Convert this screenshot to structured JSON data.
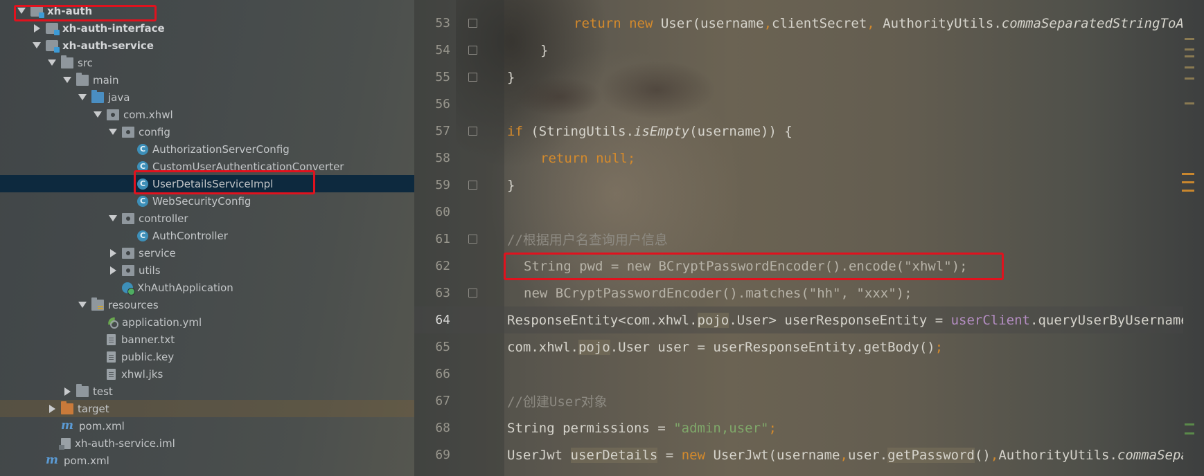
{
  "tree": {
    "items": [
      {
        "label": "xh-auth",
        "arrow": "down",
        "icon": "module",
        "depth": 0,
        "bold": true
      },
      {
        "label": "xh-auth-interface",
        "arrow": "right",
        "icon": "module",
        "depth": 1,
        "bold": true
      },
      {
        "label": "xh-auth-service",
        "arrow": "down",
        "icon": "module",
        "depth": 1,
        "bold": true
      },
      {
        "label": "src",
        "arrow": "down",
        "icon": "folder",
        "depth": 2
      },
      {
        "label": "main",
        "arrow": "down",
        "icon": "folder",
        "depth": 3
      },
      {
        "label": "java",
        "arrow": "down",
        "icon": "folder-blue",
        "depth": 4
      },
      {
        "label": "com.xhwl",
        "arrow": "down",
        "icon": "package",
        "depth": 5
      },
      {
        "label": "config",
        "arrow": "down",
        "icon": "package",
        "depth": 6
      },
      {
        "label": "AuthorizationServerConfig",
        "arrow": "none",
        "icon": "class",
        "depth": 7
      },
      {
        "label": "CustomUserAuthenticationConverter",
        "arrow": "none",
        "icon": "class",
        "depth": 7
      },
      {
        "label": "UserDetailsServiceImpl",
        "arrow": "none",
        "icon": "class",
        "depth": 7,
        "selected": true
      },
      {
        "label": "WebSecurityConfig",
        "arrow": "none",
        "icon": "class",
        "depth": 7
      },
      {
        "label": "controller",
        "arrow": "down",
        "icon": "package",
        "depth": 6
      },
      {
        "label": "AuthController",
        "arrow": "none",
        "icon": "class",
        "depth": 7
      },
      {
        "label": "service",
        "arrow": "right",
        "icon": "package",
        "depth": 6
      },
      {
        "label": "utils",
        "arrow": "right",
        "icon": "package",
        "depth": 6
      },
      {
        "label": "XhAuthApplication",
        "arrow": "none",
        "icon": "app",
        "depth": 6
      },
      {
        "label": "resources",
        "arrow": "down",
        "icon": "folder-resources",
        "depth": 4
      },
      {
        "label": "application.yml",
        "arrow": "none",
        "icon": "yml",
        "depth": 5
      },
      {
        "label": "banner.txt",
        "arrow": "none",
        "icon": "file",
        "depth": 5
      },
      {
        "label": "public.key",
        "arrow": "none",
        "icon": "file",
        "depth": 5
      },
      {
        "label": "xhwl.jks",
        "arrow": "none",
        "icon": "file",
        "depth": 5
      },
      {
        "label": "test",
        "arrow": "right",
        "icon": "folder",
        "depth": 3
      },
      {
        "label": "target",
        "arrow": "right",
        "icon": "folder-orange",
        "depth": 2,
        "target": true
      },
      {
        "label": "pom.xml",
        "arrow": "none",
        "icon": "maven",
        "depth": 2
      },
      {
        "label": "xh-auth-service.iml",
        "arrow": "none",
        "icon": "iml",
        "depth": 2
      },
      {
        "label": "pom.xml",
        "arrow": "none",
        "icon": "maven",
        "depth": 1
      }
    ]
  },
  "editor": {
    "lines": [
      {
        "num": "53",
        "fold": true,
        "indent": 4,
        "tokens": [
          {
            "t": "return new ",
            "c": "kw"
          },
          {
            "t": "User(username"
          },
          {
            "t": ",",
            "c": "kw"
          },
          {
            "t": "clientSecret"
          },
          {
            "t": ", ",
            "c": "kw"
          },
          {
            "t": "AuthorityUtils."
          },
          {
            "t": "commaSeparatedStringToAuthorityList",
            "c": "mt"
          }
        ]
      },
      {
        "num": "54",
        "fold": true,
        "indent": 2,
        "tokens": [
          {
            "t": "}"
          }
        ]
      },
      {
        "num": "55",
        "fold": true,
        "indent": 0,
        "tokens": [
          {
            "t": "}"
          }
        ]
      },
      {
        "num": "56",
        "fold": false,
        "indent": 0,
        "tokens": []
      },
      {
        "num": "57",
        "fold": true,
        "indent": 0,
        "tokens": [
          {
            "t": "if ",
            "c": "kw"
          },
          {
            "t": "(StringUtils."
          },
          {
            "t": "isEmpty",
            "c": "mt"
          },
          {
            "t": "(username)) {"
          }
        ]
      },
      {
        "num": "58",
        "fold": false,
        "indent": 2,
        "tokens": [
          {
            "t": "return null",
            "c": "kw"
          },
          {
            "t": ";",
            "c": "kw"
          }
        ]
      },
      {
        "num": "59",
        "fold": true,
        "indent": 0,
        "tokens": [
          {
            "t": "}"
          }
        ]
      },
      {
        "num": "60",
        "fold": false,
        "indent": 0,
        "tokens": []
      },
      {
        "num": "61",
        "fold": true,
        "indent": 0,
        "tokens": [
          {
            "t": "//根据用户名查询用户信息",
            "c": "cm"
          }
        ]
      },
      {
        "num": "62",
        "fold": false,
        "indent": 1,
        "tokens": [
          {
            "t": "String pwd = new BCryptPasswordEncoder().encode(\"xhwl\");",
            "c": "dim"
          }
        ]
      },
      {
        "num": "63",
        "fold": true,
        "indent": 1,
        "tokens": [
          {
            "t": "new BCryptPasswordEncoder().matches(\"hh\", \"xxx\");",
            "c": "dim"
          }
        ]
      },
      {
        "num": "64",
        "fold": false,
        "indent": 0,
        "current": true,
        "tokens": [
          {
            "t": "ResponseEntity<com.xhwl."
          },
          {
            "t": "pojo",
            "c": "hl"
          },
          {
            "t": ".User> userResponseEntity = "
          },
          {
            "t": "userClient",
            "c": "fld"
          },
          {
            "t": ".queryUserByUsername(username);"
          }
        ]
      },
      {
        "num": "65",
        "fold": false,
        "indent": 0,
        "tokens": [
          {
            "t": "com.xhwl."
          },
          {
            "t": "pojo",
            "c": "hl"
          },
          {
            "t": ".User user = userResponseEntity.getBody()"
          },
          {
            "t": ";",
            "c": "kw"
          }
        ]
      },
      {
        "num": "66",
        "fold": false,
        "indent": 0,
        "tokens": []
      },
      {
        "num": "67",
        "fold": false,
        "indent": 0,
        "tokens": [
          {
            "t": "//创建User对象",
            "c": "cm"
          }
        ]
      },
      {
        "num": "68",
        "fold": false,
        "indent": 0,
        "tokens": [
          {
            "t": "String permissions = "
          },
          {
            "t": "\"admin,user\"",
            "c": "str"
          },
          {
            "t": ";",
            "c": "kw"
          }
        ]
      },
      {
        "num": "69",
        "fold": false,
        "indent": 0,
        "tokens": [
          {
            "t": "UserJwt "
          },
          {
            "t": "userDetails",
            "c": "hl"
          },
          {
            "t": " = "
          },
          {
            "t": "new ",
            "c": "kw"
          },
          {
            "t": "UserJwt(username"
          },
          {
            "t": ",",
            "c": "kw"
          },
          {
            "t": "user."
          },
          {
            "t": "getPassword",
            "c": "hl"
          },
          {
            "t": "()"
          },
          {
            "t": ",",
            "c": "kw"
          },
          {
            "t": "AuthorityUtils."
          },
          {
            "t": "commaSeparatedStringToAuthorityList",
            "c": "mt"
          }
        ]
      }
    ]
  },
  "colors": {
    "highlight_box": "#e0121e",
    "selected_row": "#0d293e",
    "keyword": "#d48a2c",
    "string": "#7fa86a"
  }
}
